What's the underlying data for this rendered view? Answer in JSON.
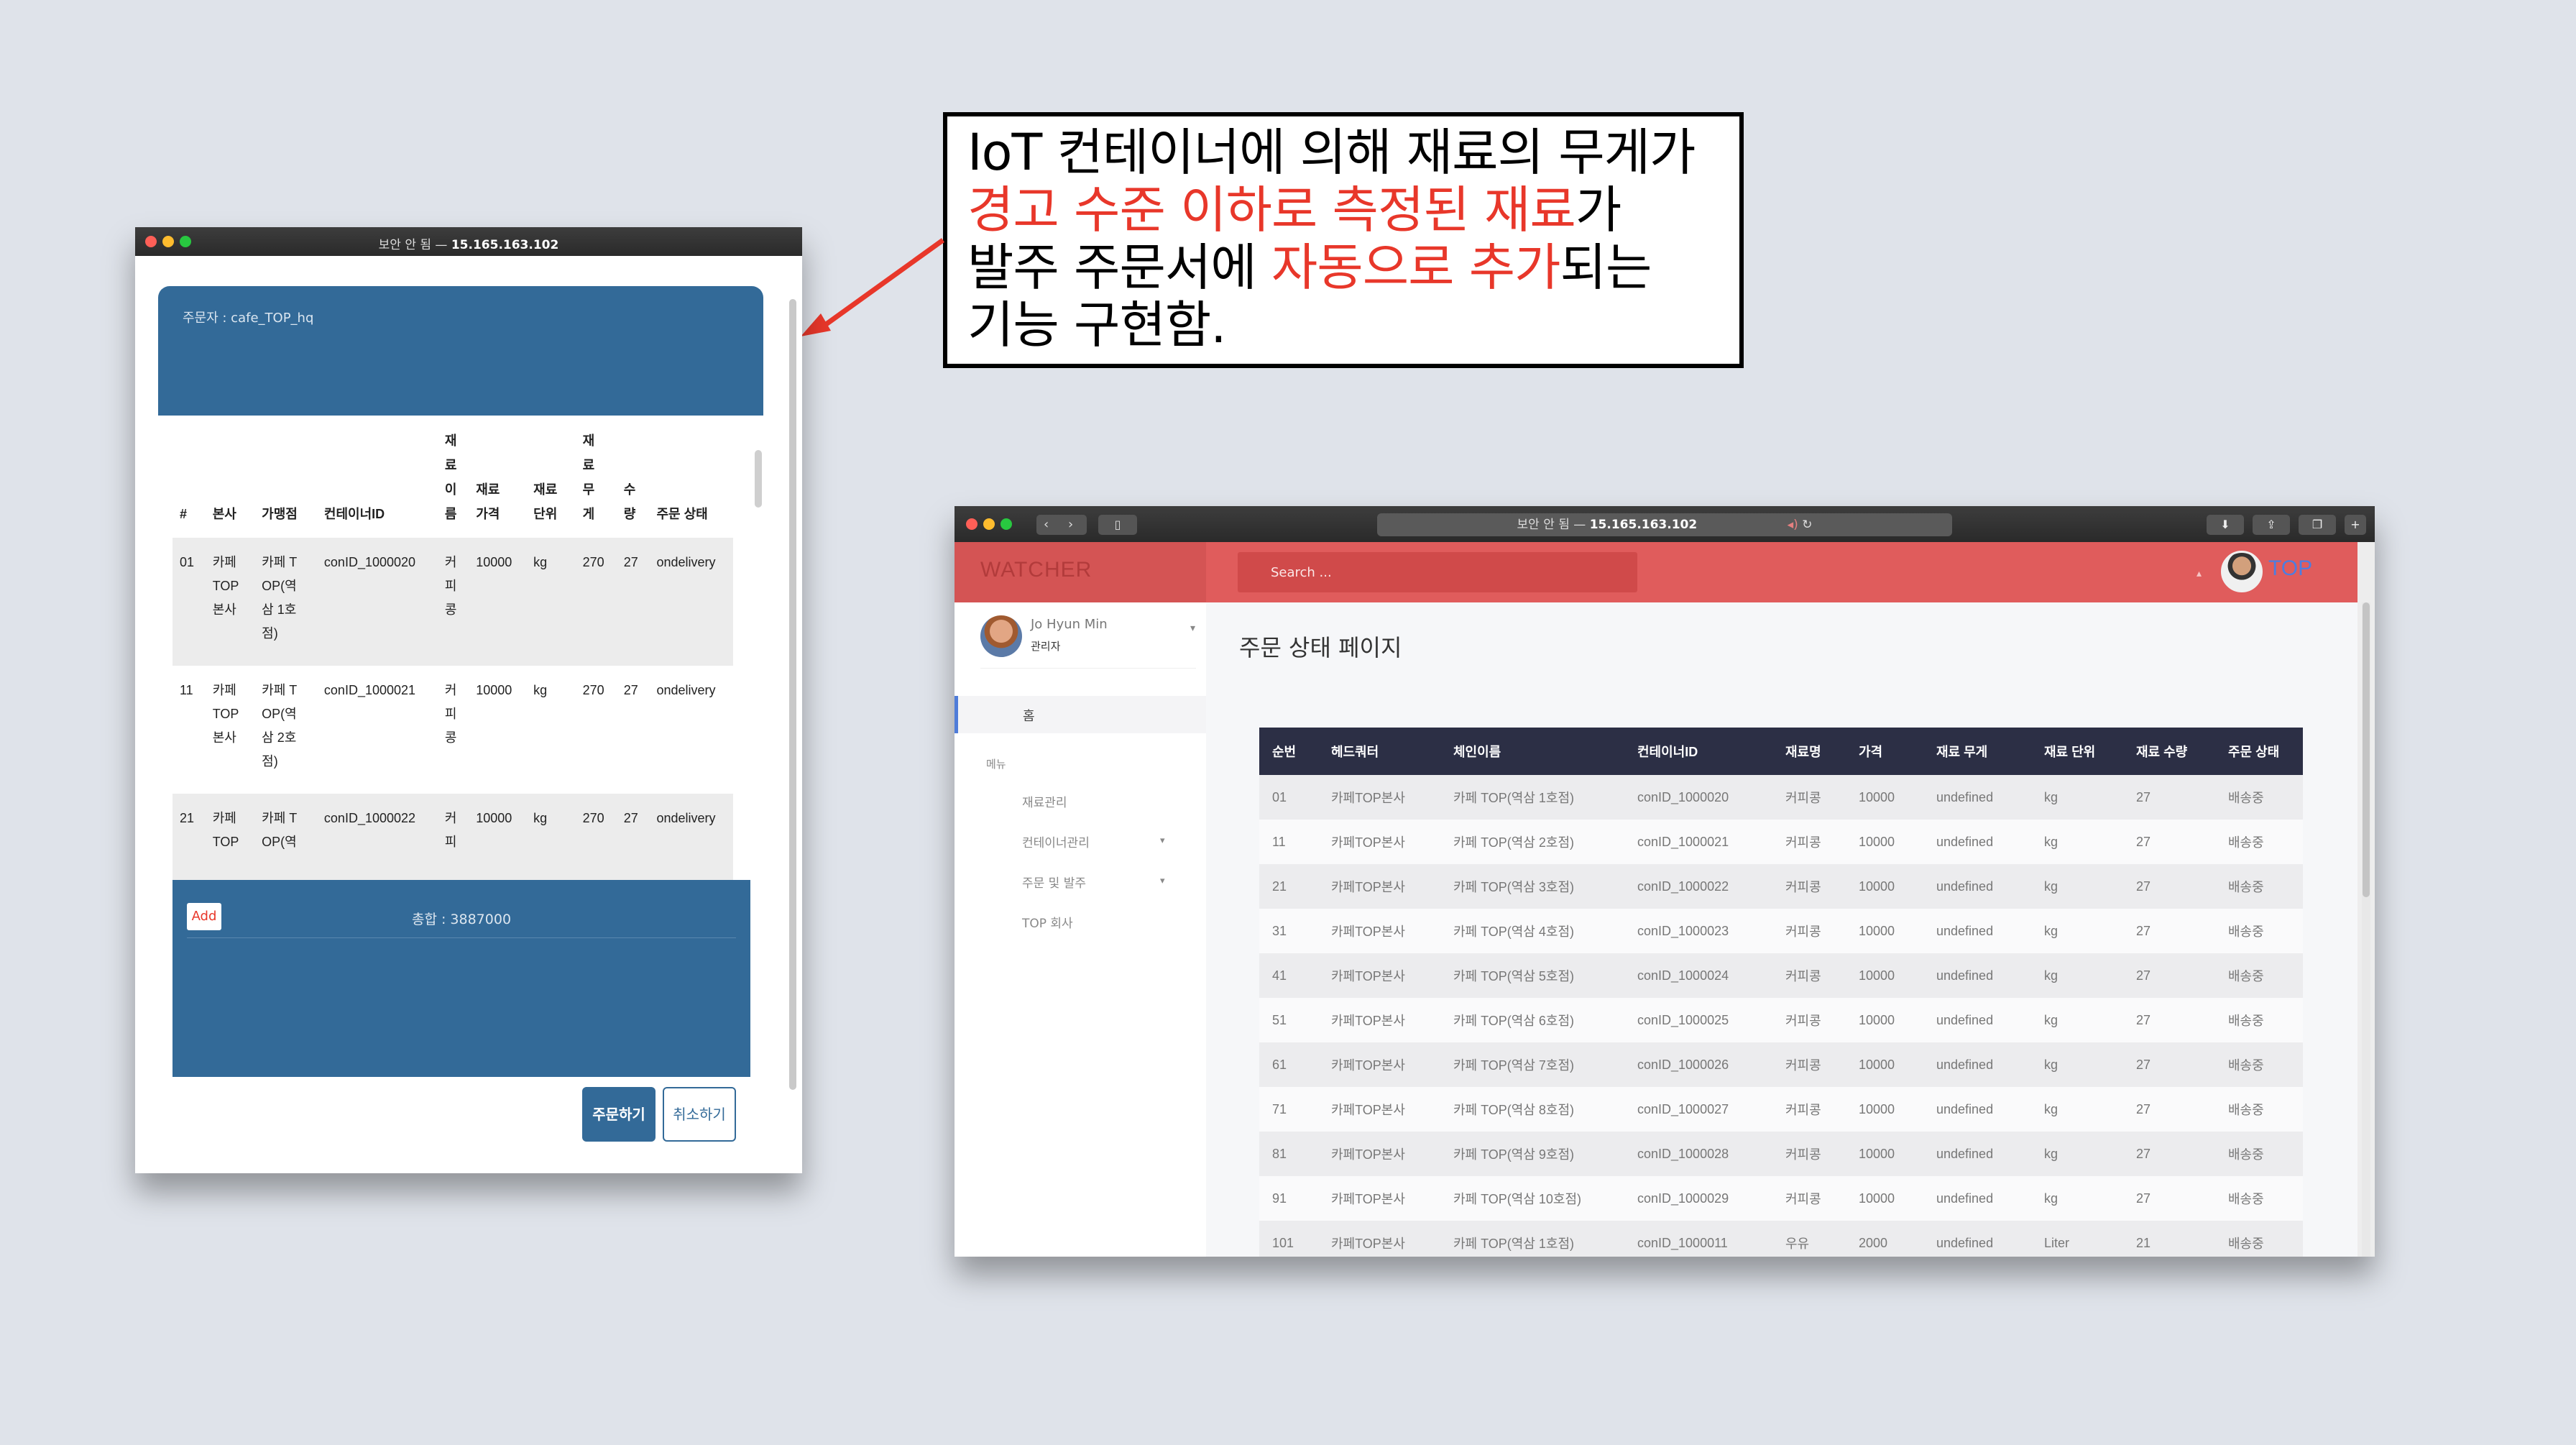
{
  "callout": {
    "lines": [
      [
        {
          "text": "IoT 컨테이너에 의해 재료의 무게가",
          "hl": false
        }
      ],
      [
        {
          "text": "경고 수준 이하로 측정된 재료",
          "hl": true
        },
        {
          "text": "가",
          "hl": false
        }
      ],
      [
        {
          "text": "발주 주문서에 ",
          "hl": false
        },
        {
          "text": "자동으로 추가",
          "hl": true
        },
        {
          "text": "되는",
          "hl": false
        }
      ],
      [
        {
          "text": "기능 구현함.",
          "hl": false
        }
      ]
    ]
  },
  "popup": {
    "title_prefix": "보안 안 됨 — ",
    "title_host": "15.165.163.102",
    "orderer": "주문자 : cafe_TOP_hq",
    "headers": [
      "#",
      "본사",
      "가맹점",
      "컨테이너ID",
      "재료이름",
      "재료가격",
      "재료단위",
      "재료무게",
      "수량",
      "주문 상태"
    ],
    "rows": [
      {
        "no": "01",
        "hq": "카페 TOP 본사",
        "store": "카페 TOP(역삼 1호점)",
        "container": "conID_1000020",
        "name": "커피콩",
        "price": "10000",
        "unit": "kg",
        "weight": "270",
        "qty": "27",
        "status": "ondelivery"
      },
      {
        "no": "11",
        "hq": "카페 TOP 본사",
        "store": "카페 TOP(역삼 2호점)",
        "container": "conID_1000021",
        "name": "커피콩",
        "price": "10000",
        "unit": "kg",
        "weight": "270",
        "qty": "27",
        "status": "ondelivery"
      },
      {
        "no": "21",
        "hq": "카페 TOP",
        "store": "카페 TOP(역",
        "container": "conID_1000022",
        "name": "커피",
        "price": "10000",
        "unit": "kg",
        "weight": "270",
        "qty": "27",
        "status": "ondelivery"
      }
    ],
    "add_label": "Add",
    "total": "총합 : 3887000",
    "order_button": "주문하기",
    "cancel_button": "취소하기"
  },
  "browser": {
    "title_prefix": "보안 안 됨 — ",
    "title_host": "15.165.163.102",
    "brand": "WATCHER",
    "search_placeholder": "Search ...",
    "top_label": "TOP",
    "user_name": "Jo Hyun Min",
    "user_role": "관리자",
    "home_label": "홈",
    "menu_title": "메뉴",
    "menu": [
      {
        "label": "재료관리",
        "caret": false
      },
      {
        "label": "컨테이너관리",
        "caret": true
      },
      {
        "label": "주문 및 발주",
        "caret": true
      },
      {
        "label": "TOP 회사",
        "caret": false
      }
    ],
    "page_title": "주문 상태 페이지",
    "headers": [
      "순번",
      "헤드쿼터",
      "체인이름",
      "컨테이너ID",
      "재료명",
      "가격",
      "재료 무게",
      "재료 단위",
      "재료 수량",
      "주문 상태"
    ],
    "rows": [
      [
        "01",
        "카페TOP본사",
        "카페 TOP(역삼 1호점)",
        "conID_1000020",
        "커피콩",
        "10000",
        "undefined",
        "kg",
        "27",
        "배송중"
      ],
      [
        "11",
        "카페TOP본사",
        "카페 TOP(역삼 2호점)",
        "conID_1000021",
        "커피콩",
        "10000",
        "undefined",
        "kg",
        "27",
        "배송중"
      ],
      [
        "21",
        "카페TOP본사",
        "카페 TOP(역삼 3호점)",
        "conID_1000022",
        "커피콩",
        "10000",
        "undefined",
        "kg",
        "27",
        "배송중"
      ],
      [
        "31",
        "카페TOP본사",
        "카페 TOP(역삼 4호점)",
        "conID_1000023",
        "커피콩",
        "10000",
        "undefined",
        "kg",
        "27",
        "배송중"
      ],
      [
        "41",
        "카페TOP본사",
        "카페 TOP(역삼 5호점)",
        "conID_1000024",
        "커피콩",
        "10000",
        "undefined",
        "kg",
        "27",
        "배송중"
      ],
      [
        "51",
        "카페TOP본사",
        "카페 TOP(역삼 6호점)",
        "conID_1000025",
        "커피콩",
        "10000",
        "undefined",
        "kg",
        "27",
        "배송중"
      ],
      [
        "61",
        "카페TOP본사",
        "카페 TOP(역삼 7호점)",
        "conID_1000026",
        "커피콩",
        "10000",
        "undefined",
        "kg",
        "27",
        "배송중"
      ],
      [
        "71",
        "카페TOP본사",
        "카페 TOP(역삼 8호점)",
        "conID_1000027",
        "커피콩",
        "10000",
        "undefined",
        "kg",
        "27",
        "배송중"
      ],
      [
        "81",
        "카페TOP본사",
        "카페 TOP(역삼 9호점)",
        "conID_1000028",
        "커피콩",
        "10000",
        "undefined",
        "kg",
        "27",
        "배송중"
      ],
      [
        "91",
        "카페TOP본사",
        "카페 TOP(역삼 10호점)",
        "conID_1000029",
        "커피콩",
        "10000",
        "undefined",
        "kg",
        "27",
        "배송중"
      ],
      [
        "101",
        "카페TOP본사",
        "카페 TOP(역삼 1호점)",
        "conID_1000011",
        "우유",
        "2000",
        "undefined",
        "Liter",
        "21",
        "배송중"
      ]
    ]
  },
  "colors": {
    "accent_red": "#e8372a",
    "order_blue": "#336a98",
    "topbar_red": "#e05c5c",
    "table_header": "#2c2f45"
  }
}
